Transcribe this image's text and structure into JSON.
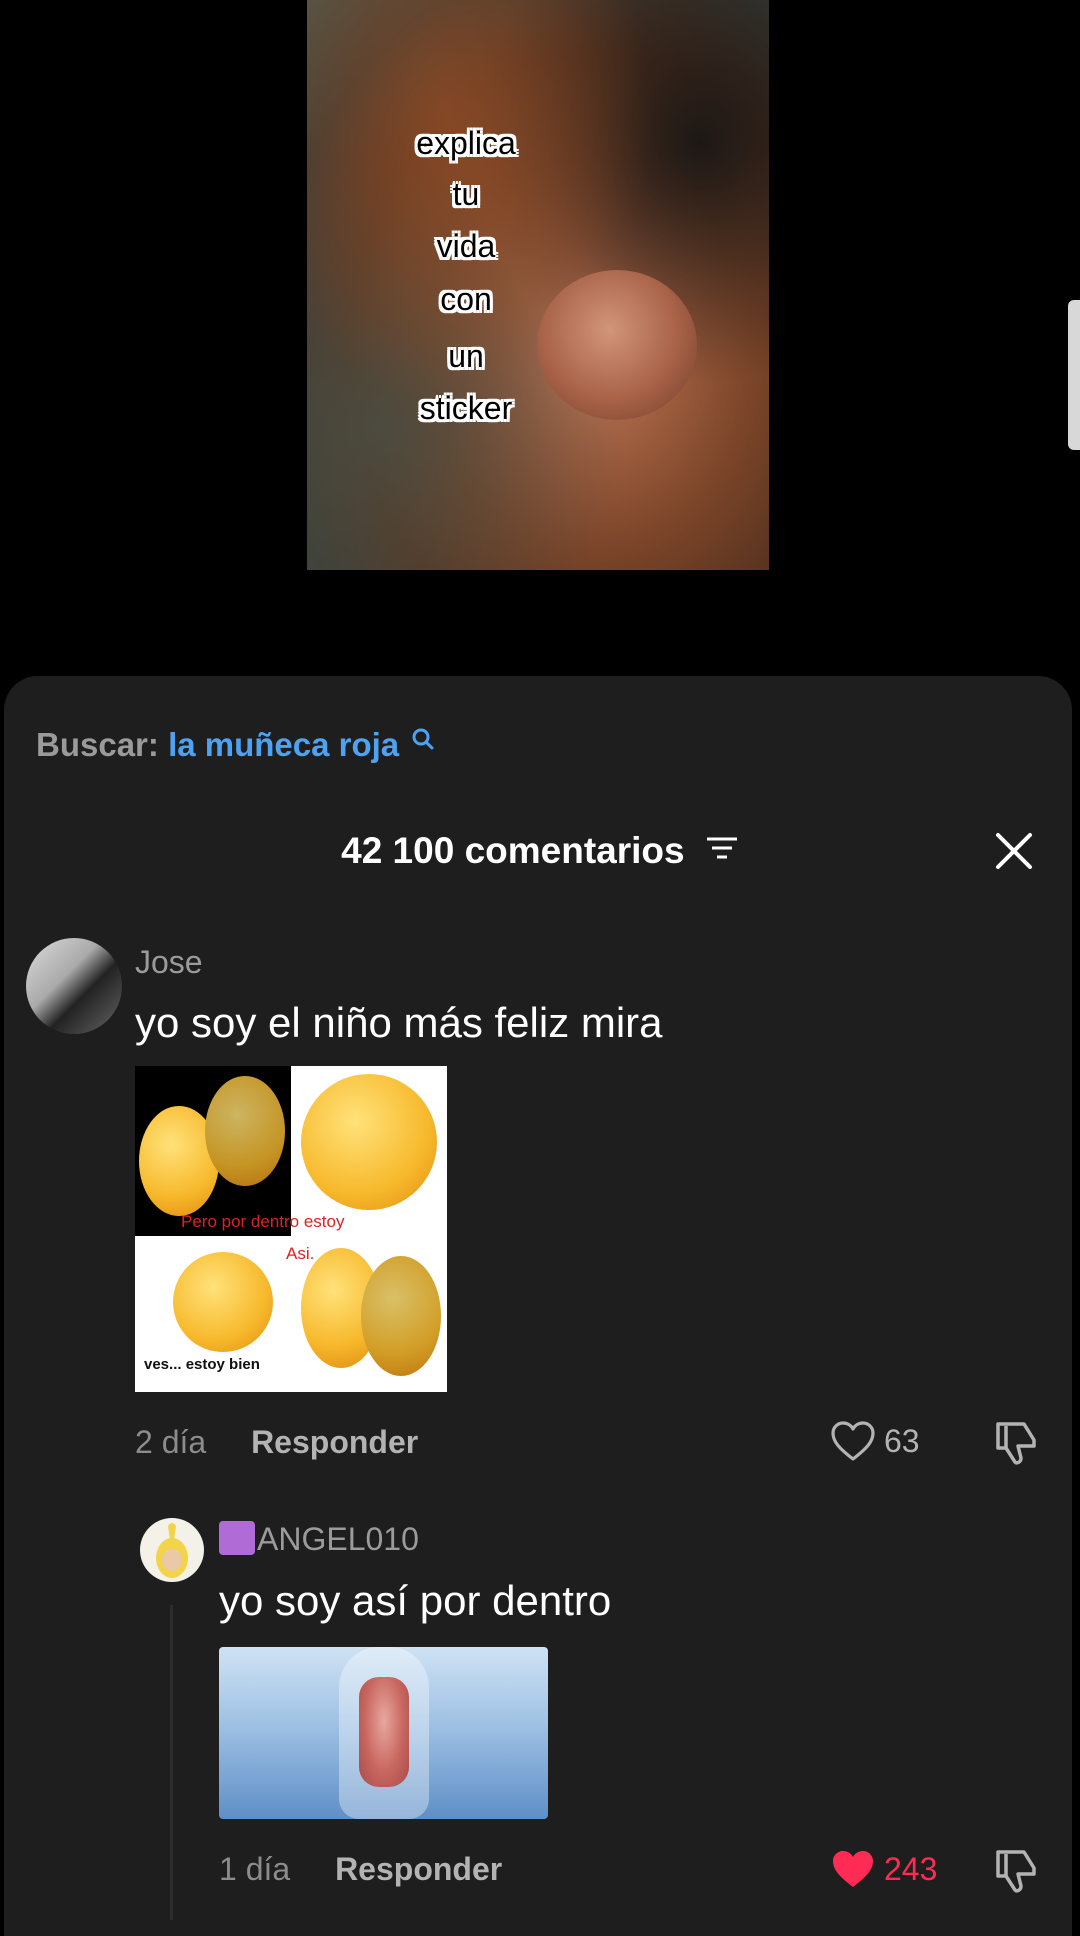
{
  "video": {
    "sticker_lines": [
      "explica",
      "tu",
      "vida",
      "con",
      "un",
      "sticker"
    ]
  },
  "search": {
    "label": "Buscar:",
    "term": "la muñeca roja"
  },
  "header": {
    "title": "42 100 comentarios"
  },
  "comments": [
    {
      "username": "Jose",
      "text": "yo soy el niño más feliz mira",
      "image_captions": {
        "top": "Pero por dentro estoy",
        "top2": "Asi.",
        "bottom": "ves... estoy bien"
      },
      "date": "2 día",
      "reply_label": "Responder",
      "likes": "63",
      "liked": false
    }
  ],
  "replies": [
    {
      "username": "ANGEL010",
      "text": "yo soy así por dentro",
      "date": "1 día",
      "reply_label": "Responder",
      "likes": "243",
      "liked": true
    }
  ],
  "colors": {
    "sheet_bg": "#1e1e1f",
    "search_link": "#4ea2f2",
    "liked_heart": "#fe2c55"
  }
}
